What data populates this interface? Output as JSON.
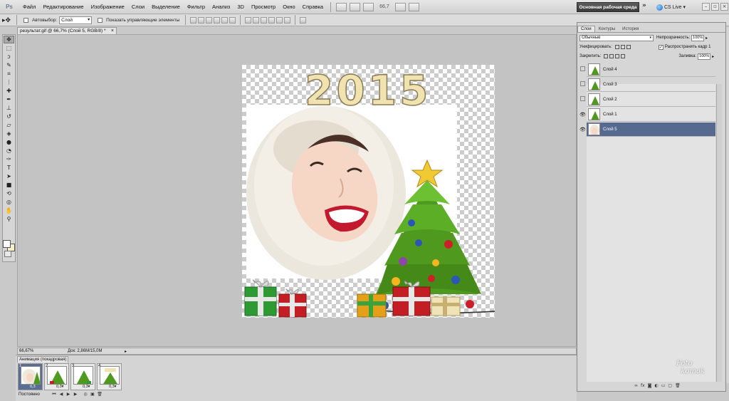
{
  "menubar": {
    "logo": "Ps",
    "items": [
      "Файл",
      "Редактирование",
      "Изображение",
      "Слои",
      "Выделение",
      "Фильтр",
      "Анализ",
      "3D",
      "Просмотр",
      "Окно",
      "Справка"
    ],
    "zoom": "66,7",
    "workspace": "Основная рабочая среда",
    "cs_live": "CS Live"
  },
  "optbar": {
    "autoselect_label": "Автовыбор:",
    "autoselect_value": "Слой",
    "show_controls_label": "Показать управляющие элементы"
  },
  "document": {
    "tab_title": "результат.gif @ 66,7% (Слой 5, RGB/8) *",
    "zoom_status": "66,67%",
    "doc_status": "Док: 2,86M/15,0M",
    "headline": "2015"
  },
  "animation": {
    "tab_label": "Анимация (покадровая)",
    "frames": [
      {
        "num": "1",
        "delay": "0,3"
      },
      {
        "num": "2",
        "delay": "0,3▾"
      },
      {
        "num": "3",
        "delay": "0,3▾"
      },
      {
        "num": "4",
        "delay": "0,3▾"
      }
    ],
    "loop": "Постоянно"
  },
  "layers_panel": {
    "tabs": [
      "Слои",
      "Контуры",
      "История"
    ],
    "blend_mode": "Обычные",
    "opacity_label": "Непрозрачность:",
    "opacity_value": "100%",
    "unify_label": "Унифицировать:",
    "propagate_label": "Распространить кадр 1",
    "lock_label": "Закрепить:",
    "fill_label": "Заливка:",
    "fill_value": "100%",
    "layers": [
      {
        "name": "Слой 4",
        "visible": false,
        "selected": false
      },
      {
        "name": "Слой 3",
        "visible": false,
        "selected": false
      },
      {
        "name": "Слой 2",
        "visible": false,
        "selected": false
      },
      {
        "name": "Слой 1",
        "visible": true,
        "selected": false
      },
      {
        "name": "Слой 5",
        "visible": true,
        "selected": true
      }
    ]
  },
  "colors": {
    "selection": "#566a8f",
    "tree": "#4f9a1e",
    "star": "#f1c933"
  }
}
